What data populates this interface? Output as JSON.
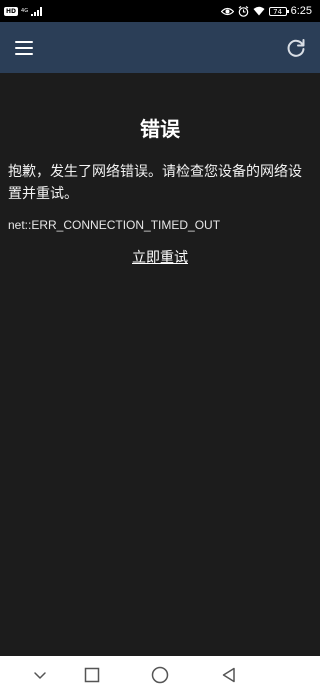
{
  "status_bar": {
    "hd_label": "HD",
    "network_label": "4G",
    "battery_level": "74",
    "time": "6:25"
  },
  "app_bar": {
    "menu_icon": "hamburger-menu-icon",
    "refresh_icon": "refresh-icon",
    "background_color": "#2b3e57"
  },
  "error_page": {
    "title": "错误",
    "message": "抱歉，发生了网络错误。请检查您设备的网络设置并重试。",
    "error_code": "net::ERR_CONNECTION_TIMED_OUT",
    "retry_label": "立即重试"
  },
  "nav_bar": {
    "back_icon": "chevron-down-icon",
    "recents_icon": "square-icon",
    "home_icon": "circle-icon",
    "triangle_icon": "triangle-back-icon"
  }
}
